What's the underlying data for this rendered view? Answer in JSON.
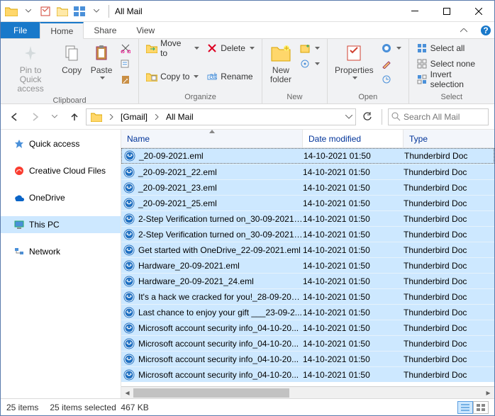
{
  "title": "All Mail",
  "tabs": {
    "file": "File",
    "home": "Home",
    "share": "Share",
    "view": "View"
  },
  "ribbon": {
    "clipboard": {
      "label": "Clipboard",
      "pin": "Pin to Quick\naccess",
      "copy": "Copy",
      "paste": "Paste"
    },
    "organize": {
      "label": "Organize",
      "move": "Move to",
      "copy_to": "Copy to",
      "delete": "Delete",
      "rename": "Rename"
    },
    "new": {
      "label": "New",
      "new_folder": "New\nfolder"
    },
    "open": {
      "label": "Open",
      "properties": "Properties"
    },
    "select": {
      "label": "Select",
      "select_all": "Select all",
      "select_none": "Select none",
      "invert": "Invert selection"
    }
  },
  "breadcrumb": {
    "seg1": "[Gmail]",
    "seg2": "All Mail"
  },
  "search": {
    "placeholder": "Search All Mail"
  },
  "navpane": {
    "quick_access": "Quick access",
    "ccf": "Creative Cloud Files",
    "onedrive": "OneDrive",
    "this_pc": "This PC",
    "network": "Network"
  },
  "columns": {
    "name": "Name",
    "date": "Date modified",
    "type": "Type"
  },
  "files": [
    {
      "name": "_20-09-2021.eml",
      "date": "14-10-2021 01:50",
      "type": "Thunderbird Doc"
    },
    {
      "name": "_20-09-2021_22.eml",
      "date": "14-10-2021 01:50",
      "type": "Thunderbird Doc"
    },
    {
      "name": "_20-09-2021_23.eml",
      "date": "14-10-2021 01:50",
      "type": "Thunderbird Doc"
    },
    {
      "name": "_20-09-2021_25.eml",
      "date": "14-10-2021 01:50",
      "type": "Thunderbird Doc"
    },
    {
      "name": "2-Step Verification turned on_30-09-2021....",
      "date": "14-10-2021 01:50",
      "type": "Thunderbird Doc"
    },
    {
      "name": "2-Step Verification turned on_30-09-2021....",
      "date": "14-10-2021 01:50",
      "type": "Thunderbird Doc"
    },
    {
      "name": "Get started with OneDrive_22-09-2021.eml",
      "date": "14-10-2021 01:50",
      "type": "Thunderbird Doc"
    },
    {
      "name": "Hardware_20-09-2021.eml",
      "date": "14-10-2021 01:50",
      "type": "Thunderbird Doc"
    },
    {
      "name": "Hardware_20-09-2021_24.eml",
      "date": "14-10-2021 01:50",
      "type": "Thunderbird Doc"
    },
    {
      "name": "It's a hack we cracked for you!_28-09-202...",
      "date": "14-10-2021 01:50",
      "type": "Thunderbird Doc"
    },
    {
      "name": "Last chance to enjoy your gift ___23-09-2...",
      "date": "14-10-2021 01:50",
      "type": "Thunderbird Doc"
    },
    {
      "name": "Microsoft account security info_04-10-20...",
      "date": "14-10-2021 01:50",
      "type": "Thunderbird Doc"
    },
    {
      "name": "Microsoft account security info_04-10-20...",
      "date": "14-10-2021 01:50",
      "type": "Thunderbird Doc"
    },
    {
      "name": "Microsoft account security info_04-10-20...",
      "date": "14-10-2021 01:50",
      "type": "Thunderbird Doc"
    },
    {
      "name": "Microsoft account security info_04-10-20...",
      "date": "14-10-2021 01:50",
      "type": "Thunderbird Doc"
    }
  ],
  "status": {
    "count": "25 items",
    "selected": "25 items selected",
    "size": "467 KB"
  }
}
